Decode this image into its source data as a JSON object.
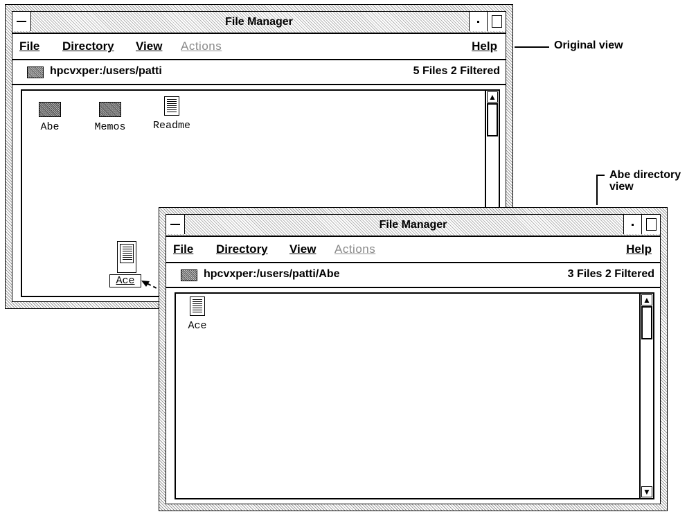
{
  "window_original": {
    "title": "File Manager",
    "menu": {
      "file": "File",
      "directory": "Directory",
      "view": "View",
      "actions": "Actions",
      "help": "Help"
    },
    "path": "hpcvxper:/users/patti",
    "count": "5 Files  2 Filtered",
    "icons": [
      {
        "label": "Abe",
        "type": "folder"
      },
      {
        "label": "Memos",
        "type": "folder"
      },
      {
        "label": "Readme",
        "type": "document"
      }
    ]
  },
  "window_abe": {
    "title": "File Manager",
    "menu": {
      "file": "File",
      "directory": "Directory",
      "view": "View",
      "actions": "Actions",
      "help": "Help"
    },
    "path": "hpcvxper:/users/patti/Abe",
    "count": "3 Files  2 Filtered",
    "icons": [
      {
        "label": "Ace",
        "type": "document"
      }
    ]
  },
  "drag_ghost": {
    "label": "Ace"
  },
  "callouts": {
    "original": "Original view",
    "abe_line1": "Abe directory",
    "abe_line2": "view"
  }
}
